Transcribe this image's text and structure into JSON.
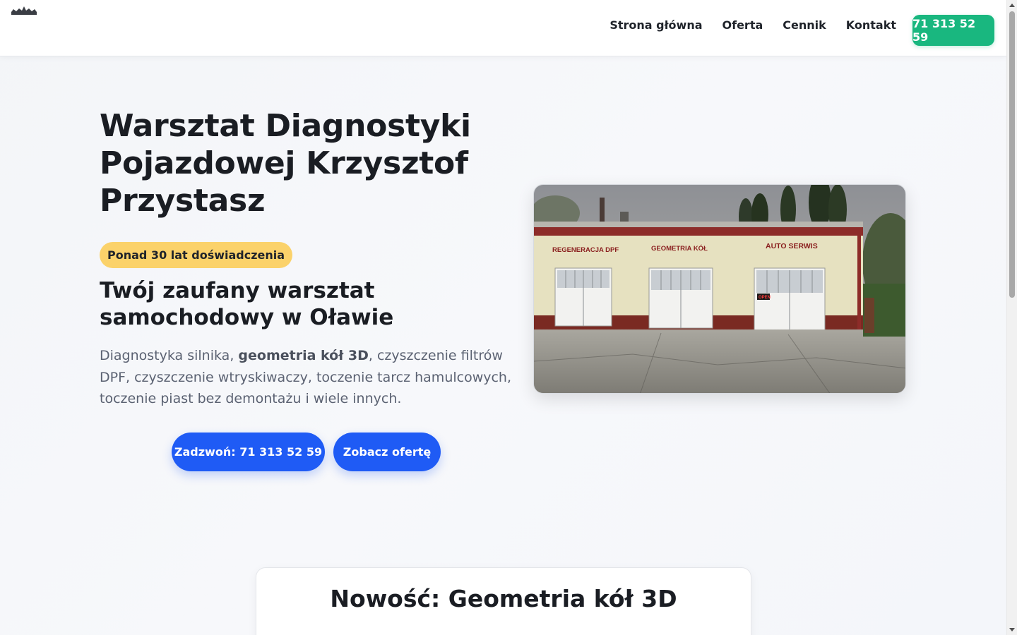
{
  "header": {
    "logo_icon": "crown-logo-icon",
    "nav": [
      {
        "label": "Strona główna"
      },
      {
        "label": "Oferta"
      },
      {
        "label": "Cennik"
      },
      {
        "label": "Kontakt"
      }
    ],
    "phone_button": "71 313 52 59",
    "accent_color": "#19b77f"
  },
  "hero": {
    "title": "Warsztat Diagnostyki Pojazdowej Krzysztof Przystasz",
    "badge": "Ponad 30 lat doświadczenia",
    "subtitle": "Twój zaufany warsztat samochodowy w Oławie",
    "desc_part1": "Diagnostyka silnika, ",
    "desc_bold": "geometria kół 3D",
    "desc_part2": ", czyszczenie filtrów DPF, czyszczenie wtryskiwaczy, toczenie tarcz hamulcowych, toczenie piast bez demontażu i wiele innych.",
    "cta_call": "Zadzwoń: 71 313 52 59",
    "cta_offer": "Zobacz ofertę",
    "cta_color": "#1f5bf5",
    "photo": {
      "sign_left": "REGENERACJA DPF",
      "sign_middle": "GEOMETRIA KÓŁ",
      "sign_right": "AUTO SERWIS",
      "open_sign": "OPEN"
    }
  },
  "news": {
    "title": "Nowość: Geometria kół 3D"
  }
}
